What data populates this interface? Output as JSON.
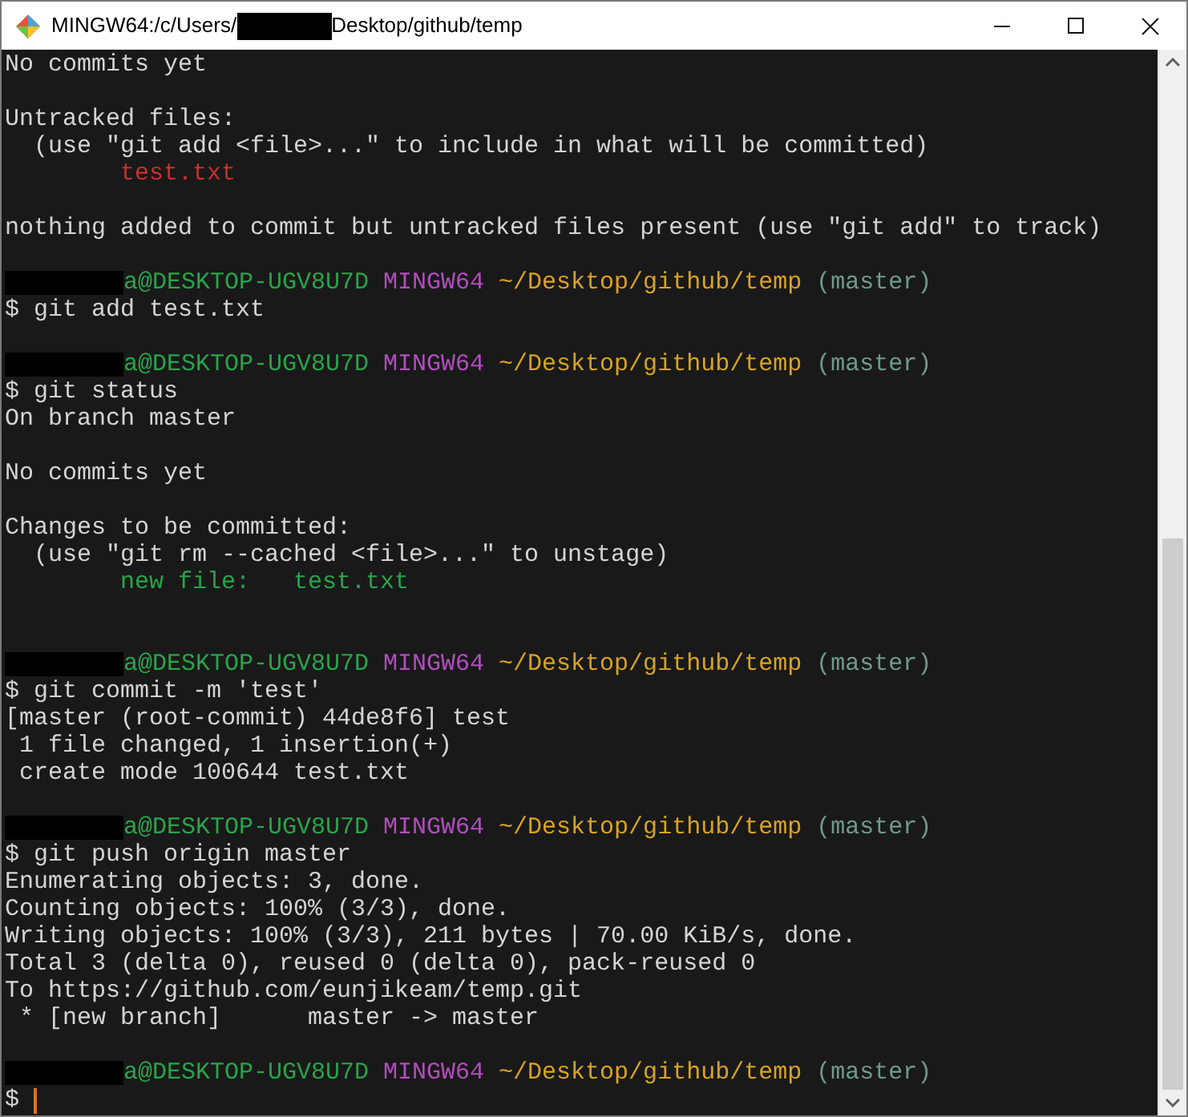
{
  "window": {
    "title_prefix": "MINGW64:/c/Users/",
    "title_suffix": "Desktop/github/temp"
  },
  "lines": [
    {
      "kind": "output",
      "text": "No commits yet"
    },
    {
      "kind": "blank"
    },
    {
      "kind": "output",
      "text": "Untracked files:"
    },
    {
      "kind": "output",
      "text": "  (use \"git add <file>...\" to include in what will be committed)"
    },
    {
      "kind": "untracked",
      "text": "        test.txt"
    },
    {
      "kind": "blank"
    },
    {
      "kind": "output",
      "text": "nothing added to commit but untracked files present (use \"git add\" to track)"
    },
    {
      "kind": "blank"
    },
    {
      "kind": "prompt",
      "user": "a@DESKTOP-UGV8U7D",
      "system": "MINGW64",
      "path": "~/Desktop/github/temp",
      "branch": "(master)"
    },
    {
      "kind": "output",
      "text": "$ git add test.txt"
    },
    {
      "kind": "blank"
    },
    {
      "kind": "prompt",
      "user": "a@DESKTOP-UGV8U7D",
      "system": "MINGW64",
      "path": "~/Desktop/github/temp",
      "branch": "(master)"
    },
    {
      "kind": "output",
      "text": "$ git status"
    },
    {
      "kind": "output",
      "text": "On branch master"
    },
    {
      "kind": "blank"
    },
    {
      "kind": "output",
      "text": "No commits yet"
    },
    {
      "kind": "blank"
    },
    {
      "kind": "output",
      "text": "Changes to be committed:"
    },
    {
      "kind": "output",
      "text": "  (use \"git rm --cached <file>...\" to unstage)"
    },
    {
      "kind": "staged",
      "text": "        new file:   test.txt"
    },
    {
      "kind": "blank"
    },
    {
      "kind": "blank"
    },
    {
      "kind": "prompt",
      "user": "a@DESKTOP-UGV8U7D",
      "system": "MINGW64",
      "path": "~/Desktop/github/temp",
      "branch": "(master)"
    },
    {
      "kind": "output",
      "text": "$ git commit -m 'test'"
    },
    {
      "kind": "output",
      "text": "[master (root-commit) 44de8f6] test"
    },
    {
      "kind": "output",
      "text": " 1 file changed, 1 insertion(+)"
    },
    {
      "kind": "output",
      "text": " create mode 100644 test.txt"
    },
    {
      "kind": "blank"
    },
    {
      "kind": "prompt",
      "user": "a@DESKTOP-UGV8U7D",
      "system": "MINGW64",
      "path": "~/Desktop/github/temp",
      "branch": "(master)"
    },
    {
      "kind": "output",
      "text": "$ git push origin master"
    },
    {
      "kind": "output",
      "text": "Enumerating objects: 3, done."
    },
    {
      "kind": "output",
      "text": "Counting objects: 100% (3/3), done."
    },
    {
      "kind": "output",
      "text": "Writing objects: 100% (3/3), 211 bytes | 70.00 KiB/s, done."
    },
    {
      "kind": "output",
      "text": "Total 3 (delta 0), reused 0 (delta 0), pack-reused 0"
    },
    {
      "kind": "output",
      "text": "To https://github.com/eunjikeam/temp.git"
    },
    {
      "kind": "output",
      "text": " * [new branch]      master -> master"
    },
    {
      "kind": "blank"
    },
    {
      "kind": "prompt",
      "user": "a@DESKTOP-UGV8U7D",
      "system": "MINGW64",
      "path": "~/Desktop/github/temp",
      "branch": "(master)"
    },
    {
      "kind": "input",
      "text": "$"
    }
  ]
}
